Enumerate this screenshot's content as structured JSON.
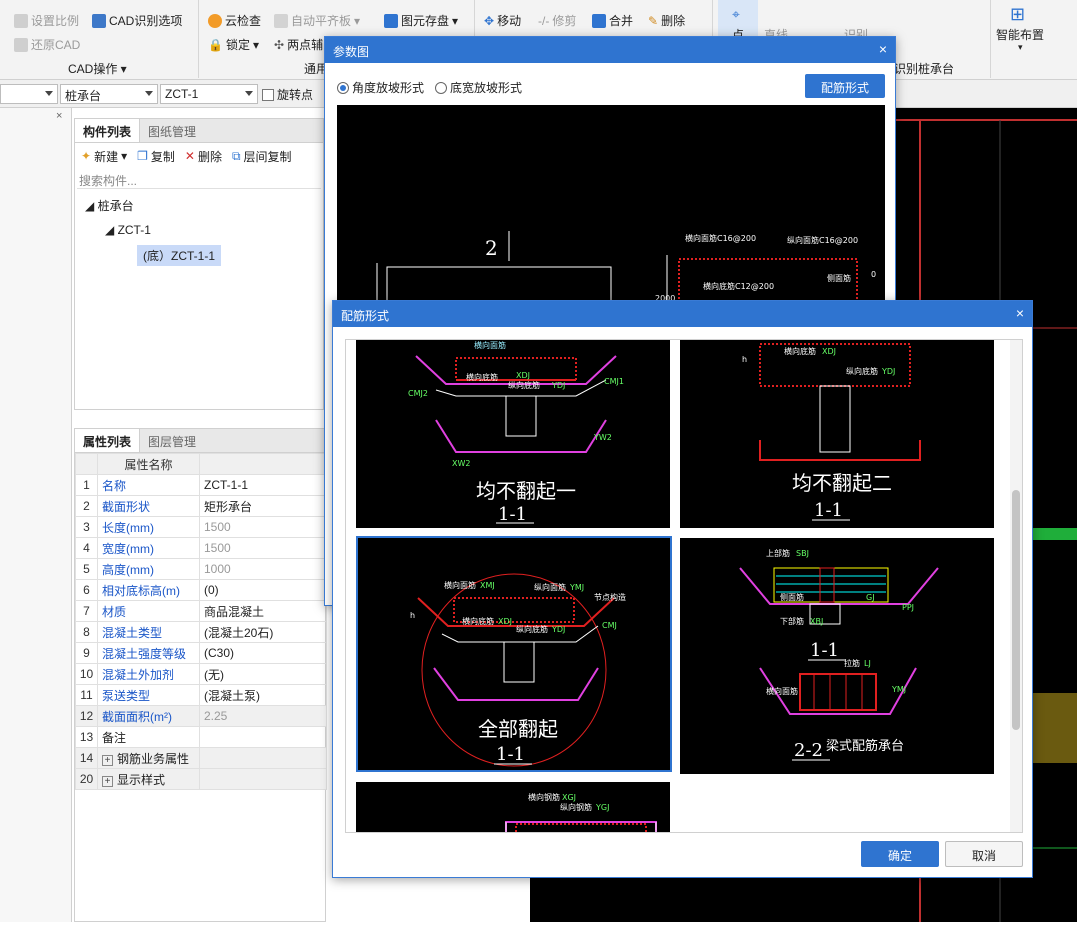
{
  "ribbon": {
    "cad_ops": {
      "set_scale": "设置比例",
      "restore_cad": "还原CAD",
      "cad_recognize_options": "CAD识别选项",
      "group_label": "CAD操作"
    },
    "general": {
      "cloud_check": "云检查",
      "auto_flat_slab": "自动平齐板",
      "lock": "锁定",
      "two_point": "两点辅",
      "group_label": "通用"
    },
    "edit": {
      "save_element": "图元存盘",
      "move": "移动",
      "trim": "修剪",
      "merge": "合并",
      "delete": "删除"
    },
    "draw": {
      "point": "点",
      "line": "直线",
      "identify": "识别"
    },
    "pile_group": {
      "label": "识别桩承台"
    },
    "smart": {
      "smart_layout": "智能布置"
    }
  },
  "toolbar2": {
    "category": "桩承台",
    "component": "ZCT-1",
    "rotate_point_label": "旋转点"
  },
  "component_panel": {
    "tabs": [
      "构件列表",
      "图纸管理"
    ],
    "actions": {
      "new": "新建",
      "copy": "复制",
      "delete": "删除",
      "floor_copy": "层间复制"
    },
    "search_placeholder": "搜索构件...",
    "tree": {
      "root": "桩承台",
      "child": "ZCT-1",
      "leaf": "(底）ZCT-1-1"
    }
  },
  "property_panel": {
    "tabs": [
      "属性列表",
      "图层管理"
    ],
    "header": "属性名称",
    "rows": [
      {
        "no": "1",
        "name": "名称",
        "value": "ZCT-1-1"
      },
      {
        "no": "2",
        "name": "截面形状",
        "value": "矩形承台"
      },
      {
        "no": "3",
        "name": "长度(mm)",
        "value": "1500"
      },
      {
        "no": "4",
        "name": "宽度(mm)",
        "value": "1500"
      },
      {
        "no": "5",
        "name": "高度(mm)",
        "value": "1000"
      },
      {
        "no": "6",
        "name": "相对底标高(m)",
        "value": "(0)"
      },
      {
        "no": "7",
        "name": "材质",
        "value": "商品混凝土"
      },
      {
        "no": "8",
        "name": "混凝土类型",
        "value": "(混凝土20石)"
      },
      {
        "no": "9",
        "name": "混凝土强度等级",
        "value": "(C30)"
      },
      {
        "no": "10",
        "name": "混凝土外加剂",
        "value": "(无)"
      },
      {
        "no": "11",
        "name": "泵送类型",
        "value": "(混凝土泵)"
      },
      {
        "no": "12",
        "name": "截面面积(m²)",
        "value": "2.25"
      },
      {
        "no": "13",
        "name": "备注",
        "value": ""
      },
      {
        "no": "14",
        "name": "钢筋业务属性",
        "value": ""
      },
      {
        "no": "20",
        "name": "显示样式",
        "value": ""
      }
    ]
  },
  "param_dialog": {
    "title": "参数图",
    "radio_angle": "角度放坡形式",
    "radio_width": "底宽放坡形式",
    "rebar_button": "配筋形式",
    "drawing": {
      "section_mark": "2",
      "h_top": "横向面筋C16@200",
      "v_top": "纵向面筋C16@200",
      "h_bot": "横向底筋C12@200",
      "side": "侧面筋",
      "zero": "0",
      "dim": "2000"
    }
  },
  "rebar_dialog": {
    "title": "配筋形式",
    "options": [
      {
        "title": "均不翻起一",
        "section": "1-1"
      },
      {
        "title": "均不翻起二",
        "section": "1-1"
      },
      {
        "title": "全部翻起",
        "section": "1-1"
      },
      {
        "title": "梁式配筋承台",
        "section": "1-1",
        "section2": "2-2"
      }
    ],
    "labels": {
      "mj": "横向面筋",
      "mj2": "纵向面筋",
      "dj": "横向底筋",
      "ydj": "纵向底筋",
      "xdj": "XDJ",
      "ydj_code": "YDJ",
      "xmj": "XMJ",
      "ymj": "YMJ",
      "cmj": "CMJ",
      "cmj1": "CMJ1",
      "cmj2": "CMJ2",
      "xw2": "XW2",
      "yw2": "YW2",
      "side": "CMJ",
      "top_bar": "上部筋",
      "bot_bar": "下部筋",
      "sbj": "SBJ",
      "xbj": "XBJ",
      "gj": "GJ",
      "ppj": "PPJ",
      "hjj": "拉筋",
      "lj": "LJ",
      "h": "h",
      "xg": "横向钢筋",
      "xgj": "XGJ",
      "zg": "纵向钢筋",
      "ygj": "YGJ",
      "jq": "节点构造",
      "cm": "侧面筋"
    },
    "ok": "确定",
    "cancel": "取消"
  }
}
